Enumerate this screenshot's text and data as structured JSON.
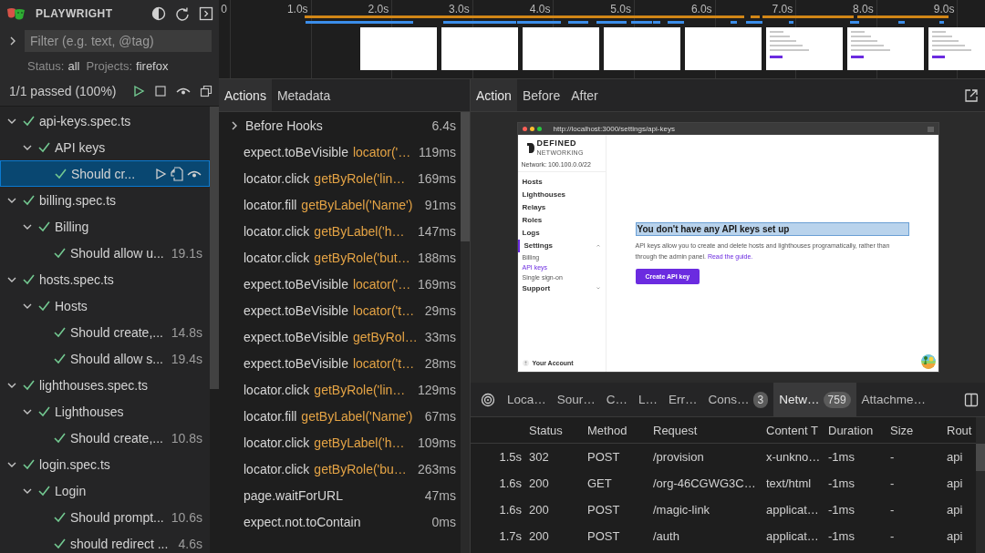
{
  "app": {
    "title": "PLAYWRIGHT"
  },
  "filter": {
    "placeholder": "Filter (e.g. text, @tag)",
    "expanded": false
  },
  "filter_summary": {
    "status_label": "Status:",
    "status": "all",
    "projects_label": "Projects:",
    "projects": "firefox"
  },
  "summary": "1/1 passed (100%)",
  "tests": [
    {
      "label": "api-keys.spec.ts",
      "passed": true,
      "expanded": true,
      "children": [
        {
          "label": "API keys",
          "passed": true,
          "expanded": true,
          "children": [
            {
              "label": "Should cr...",
              "passed": true,
              "selected": true
            }
          ]
        }
      ]
    },
    {
      "label": "billing.spec.ts",
      "passed": true,
      "expanded": true,
      "children": [
        {
          "label": "Billing",
          "passed": true,
          "expanded": true,
          "children": [
            {
              "label": "Should allow u...",
              "duration": "19.1s",
              "passed": true,
              "selected": false
            }
          ]
        }
      ]
    },
    {
      "label": "hosts.spec.ts",
      "passed": true,
      "expanded": true,
      "children": [
        {
          "label": "Hosts",
          "passed": true,
          "expanded": true,
          "children": [
            {
              "label": "Should create,...",
              "duration": "14.8s",
              "passed": true,
              "selected": false
            },
            {
              "label": "Should allow s...",
              "duration": "19.4s",
              "passed": true,
              "selected": false
            }
          ]
        }
      ]
    },
    {
      "label": "lighthouses.spec.ts",
      "passed": true,
      "expanded": true,
      "children": [
        {
          "label": "Lighthouses",
          "passed": true,
          "expanded": true,
          "children": [
            {
              "label": "Should create,...",
              "duration": "10.8s",
              "passed": true,
              "selected": false
            }
          ]
        }
      ]
    },
    {
      "label": "login.spec.ts",
      "passed": true,
      "expanded": true,
      "children": [
        {
          "label": "Login",
          "passed": true,
          "expanded": true,
          "children": [
            {
              "label": "Should prompt...",
              "duration": "10.6s",
              "passed": true,
              "selected": false
            },
            {
              "label": "should redirect ...",
              "duration": "4.6s",
              "passed": true,
              "selected": false
            }
          ]
        }
      ]
    }
  ],
  "timeline": {
    "ticks": [
      "0",
      "1.0s",
      "2.0s",
      "3.0s",
      "4.0s",
      "5.0s",
      "6.0s",
      "7.0s",
      "8.0s",
      "9.0s"
    ],
    "thumbnails": [
      {
        "kind": "blank"
      },
      {
        "kind": "blank"
      },
      {
        "kind": "blank"
      },
      {
        "kind": "blank"
      },
      {
        "kind": "blank"
      },
      {
        "kind": "page"
      },
      {
        "kind": "page"
      },
      {
        "kind": "page"
      }
    ]
  },
  "action_tabs": [
    {
      "label": "Actions",
      "selected": true
    },
    {
      "label": "Metadata",
      "selected": false
    }
  ],
  "actions": [
    {
      "kind": "hook",
      "title": "Before Hooks",
      "duration": "6.4s",
      "expanded": false
    },
    {
      "kind": "step",
      "title": "expect.toBeVisible",
      "selector": "locator('…",
      "duration": "119ms"
    },
    {
      "kind": "step",
      "title": "locator.click",
      "selector": "getByRole('lin…",
      "duration": "169ms"
    },
    {
      "kind": "step",
      "title": "locator.fill",
      "selector": "getByLabel('Name')",
      "duration": "91ms"
    },
    {
      "kind": "step",
      "title": "locator.click",
      "selector": "getByLabel('h…",
      "duration": "147ms"
    },
    {
      "kind": "step",
      "title": "locator.click",
      "selector": "getByRole('but…",
      "duration": "188ms"
    },
    {
      "kind": "step",
      "title": "expect.toBeVisible",
      "selector": "locator('…",
      "duration": "169ms"
    },
    {
      "kind": "step",
      "title": "expect.toBeVisible",
      "selector": "locator('t…",
      "duration": "29ms"
    },
    {
      "kind": "step",
      "title": "expect.toBeVisible",
      "selector": "getByRol…",
      "duration": "33ms"
    },
    {
      "kind": "step",
      "title": "expect.toBeVisible",
      "selector": "locator('t…",
      "duration": "28ms"
    },
    {
      "kind": "step",
      "title": "locator.click",
      "selector": "getByRole('lin…",
      "duration": "129ms"
    },
    {
      "kind": "step",
      "title": "locator.fill",
      "selector": "getByLabel('Name')",
      "duration": "67ms"
    },
    {
      "kind": "step",
      "title": "locator.click",
      "selector": "getByLabel('h…",
      "duration": "109ms"
    },
    {
      "kind": "step",
      "title": "locator.click",
      "selector": "getByRole('bu…",
      "duration": "263ms"
    },
    {
      "kind": "step",
      "title": "page.waitForURL",
      "duration": "47ms"
    },
    {
      "kind": "step",
      "title": "expect.not.toContain",
      "duration": "0ms"
    }
  ],
  "snapshot_tabs": [
    {
      "label": "Action",
      "selected": true
    },
    {
      "label": "Before",
      "selected": false
    },
    {
      "label": "After",
      "selected": false
    }
  ],
  "snapshot": {
    "url": "http://localhost:3000/settings/api-keys",
    "brand": "DEFINED",
    "brand_sub": "NETWORKING",
    "network": "Network: 100.100.0.0/22",
    "nav": [
      {
        "label": "Hosts",
        "selected": false
      },
      {
        "label": "Lighthouses",
        "selected": false
      },
      {
        "label": "Relays",
        "selected": false
      },
      {
        "label": "Roles",
        "selected": false
      },
      {
        "label": "Logs",
        "selected": false
      },
      {
        "label": "Settings",
        "selected": true,
        "expanded": true,
        "children": [
          {
            "label": "Billing",
            "selected": false
          },
          {
            "label": "API keys",
            "selected": true
          },
          {
            "label": "Single sign-on",
            "selected": false
          }
        ]
      },
      {
        "label": "Support",
        "selected": false,
        "expanded": false
      }
    ],
    "account": "Your Account",
    "heading": "You don't have any API keys set up",
    "heading_highlighted": true,
    "body": "API keys allow you to create and delete hosts and lighthouses programatically, rather than through the admin panel.",
    "link": "Read the guide.",
    "button": "Create API key"
  },
  "panel_tabs": [
    {
      "label": "Loca…",
      "selected": false
    },
    {
      "label": "Sour…",
      "selected": false
    },
    {
      "label": "C…",
      "selected": false
    },
    {
      "label": "L…",
      "selected": false
    },
    {
      "label": "Err…",
      "selected": false
    },
    {
      "label": "Cons…",
      "count": "3",
      "selected": false
    },
    {
      "label": "Netw…",
      "count": "759",
      "selected": true
    },
    {
      "label": "Attachme…",
      "selected": false
    }
  ],
  "network": {
    "columns": [
      "",
      "Status",
      "Method",
      "Request",
      "Content T",
      "Duration",
      "Size",
      "Rout"
    ],
    "rows": [
      [
        "1.5s",
        "302",
        "POST",
        "/provision",
        "x-unkno…",
        "-1ms",
        "-",
        "api"
      ],
      [
        "1.6s",
        "200",
        "GET",
        "/org-46CGWG3C…",
        "text/html",
        "-1ms",
        "-",
        "api"
      ],
      [
        "1.6s",
        "200",
        "POST",
        "/magic-link",
        "applicat…",
        "-1ms",
        "-",
        "api"
      ],
      [
        "1.7s",
        "200",
        "POST",
        "/auth",
        "applicat…",
        "-1ms",
        "-",
        "api"
      ]
    ]
  }
}
